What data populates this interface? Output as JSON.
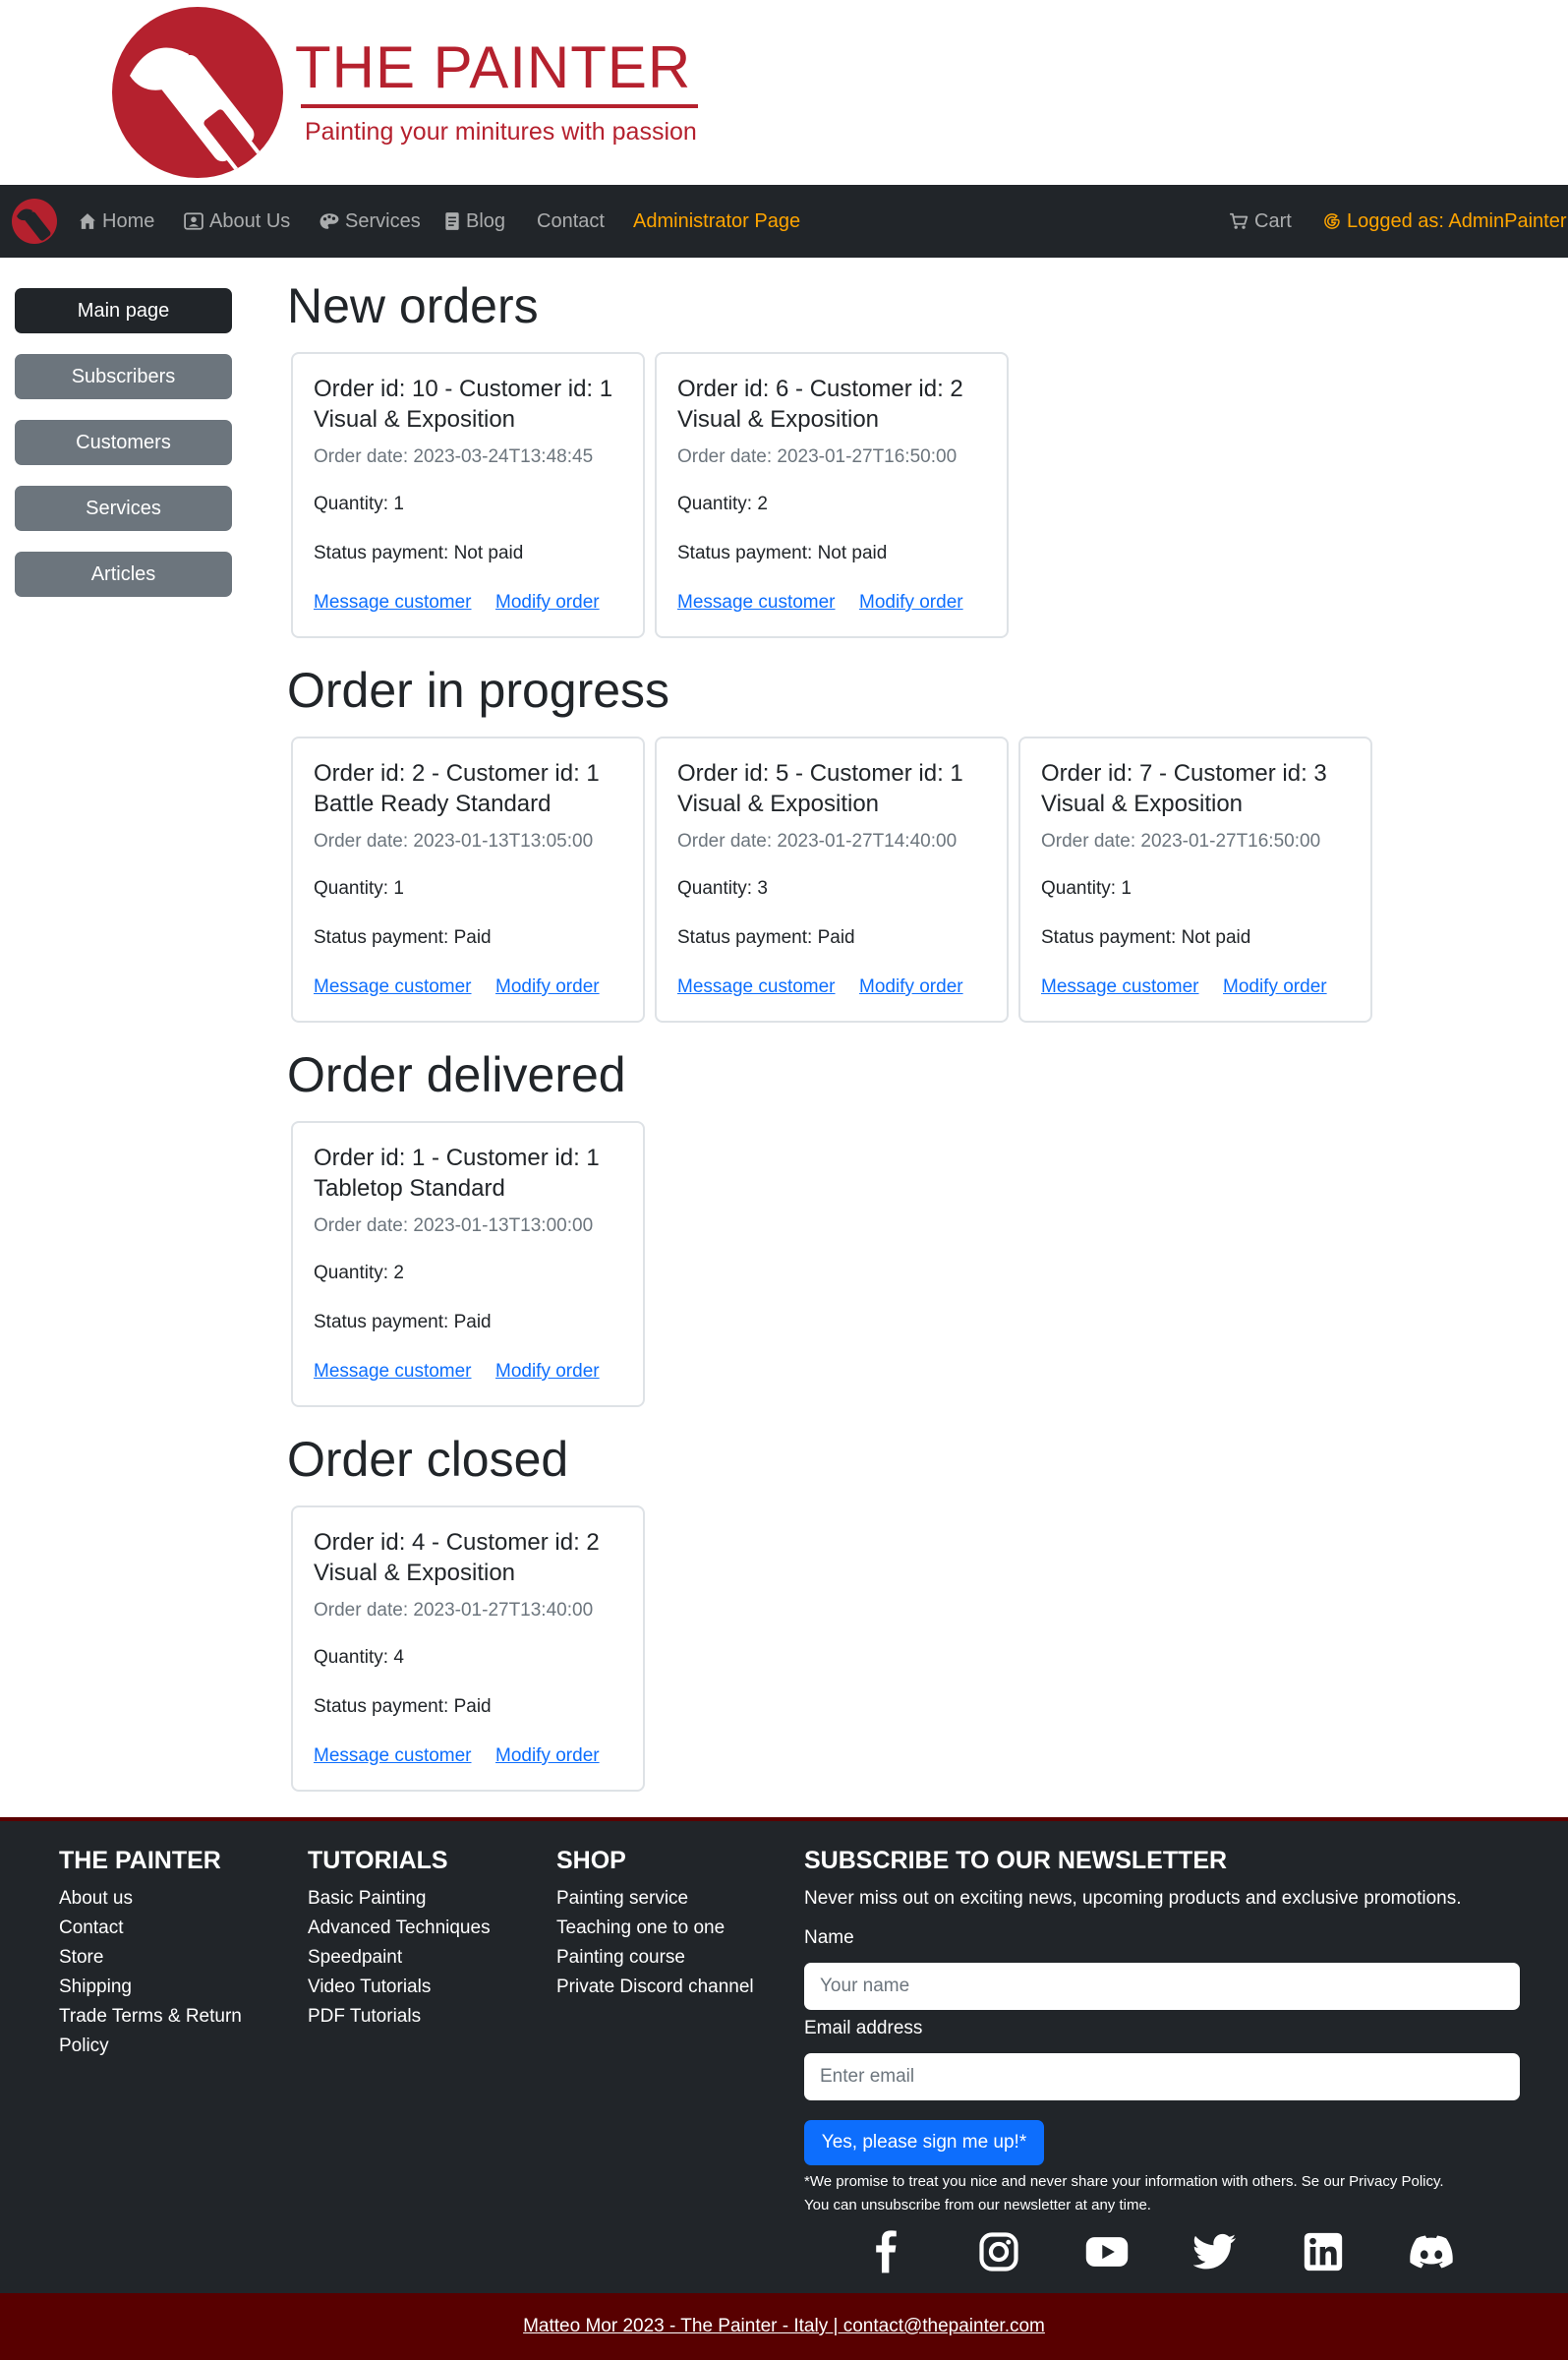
{
  "header": {
    "logo_title": "THE PAINTER",
    "logo_subtitle": "Painting your minitures with passion",
    "brand_color": "#b5212e"
  },
  "navbar": {
    "items": [
      {
        "label": "Home",
        "icon": "house-icon"
      },
      {
        "label": "About Us",
        "icon": "person-badge-icon"
      },
      {
        "label": "Services",
        "icon": "palette-icon"
      },
      {
        "label": "Blog",
        "icon": "document-icon"
      },
      {
        "label": "Contact",
        "icon": ""
      }
    ],
    "admin_label": "Administrator Page",
    "cart_label": "Cart",
    "logged_label": "Logged as: AdminPainter",
    "accent_color": "#ffa500"
  },
  "sidebar": {
    "items": [
      {
        "label": "Main page",
        "active": true
      },
      {
        "label": "Subscribers",
        "active": false
      },
      {
        "label": "Customers",
        "active": false
      },
      {
        "label": "Services",
        "active": false
      },
      {
        "label": "Articles",
        "active": false
      }
    ]
  },
  "sections": [
    {
      "title": "New orders",
      "cards": [
        {
          "line1": "Order id: 10 - Customer id: 1",
          "line2": "Visual & Exposition",
          "date": "Order date: 2023-03-24T13:48:45",
          "quantity": "Quantity: 1",
          "status": "Status payment: Not paid",
          "msg": "Message customer",
          "modify": "Modify order"
        },
        {
          "line1": "Order id: 6 - Customer id: 2",
          "line2": "Visual & Exposition",
          "date": "Order date: 2023-01-27T16:50:00",
          "quantity": "Quantity: 2",
          "status": "Status payment: Not paid",
          "msg": "Message customer",
          "modify": "Modify order"
        }
      ]
    },
    {
      "title": "Order in progress",
      "cards": [
        {
          "line1": "Order id: 2 - Customer id: 1",
          "line2": "Battle Ready Standard",
          "date": "Order date: 2023-01-13T13:05:00",
          "quantity": "Quantity: 1",
          "status": "Status payment: Paid",
          "msg": "Message customer",
          "modify": "Modify order"
        },
        {
          "line1": "Order id: 5 - Customer id: 1",
          "line2": "Visual & Exposition",
          "date": "Order date: 2023-01-27T14:40:00",
          "quantity": "Quantity: 3",
          "status": "Status payment: Paid",
          "msg": "Message customer",
          "modify": "Modify order"
        },
        {
          "line1": "Order id: 7 - Customer id: 3",
          "line2": "Visual & Exposition",
          "date": "Order date: 2023-01-27T16:50:00",
          "quantity": "Quantity: 1",
          "status": "Status payment: Not paid",
          "msg": "Message customer",
          "modify": "Modify order"
        }
      ]
    },
    {
      "title": "Order delivered",
      "cards": [
        {
          "line1": "Order id: 1 - Customer id: 1",
          "line2": "Tabletop Standard",
          "date": "Order date: 2023-01-13T13:00:00",
          "quantity": "Quantity: 2",
          "status": "Status payment: Paid",
          "msg": "Message customer",
          "modify": "Modify order"
        }
      ]
    },
    {
      "title": "Order closed",
      "cards": [
        {
          "line1": "Order id: 4 - Customer id: 2",
          "line2": "Visual & Exposition",
          "date": "Order date: 2023-01-27T13:40:00",
          "quantity": "Quantity: 4",
          "status": "Status payment: Paid",
          "msg": "Message customer",
          "modify": "Modify order"
        }
      ]
    }
  ],
  "footer": {
    "columns": [
      {
        "heading": "THE PAINTER",
        "links": [
          "About us",
          "Contact",
          "Store",
          "Shipping",
          "Trade Terms & Return",
          "Policy"
        ]
      },
      {
        "heading": "TUTORIALS",
        "links": [
          "Basic Painting",
          "Advanced Techniques",
          "Speedpaint",
          "Video Tutorials",
          "PDF Tutorials"
        ]
      },
      {
        "heading": "SHOP",
        "links": [
          "Painting service",
          "Teaching one to one",
          "Painting course",
          "Private Discord channel"
        ]
      }
    ],
    "newsletter": {
      "heading": "SUBSCRIBE TO OUR NEWSLETTER",
      "intro": "Never miss out on exciting news, upcoming products and exclusive promotions.",
      "name_label": "Name",
      "name_placeholder": "Your name",
      "email_label": "Email address",
      "email_placeholder": "Enter email",
      "button": "Yes, please sign me up!*",
      "note1": "*We promise to treat you nice and never share your information with others. Se our Privacy Policy.",
      "note2": "You can unsubscribe from our newsletter at any time."
    },
    "social": [
      "facebook-icon",
      "instagram-icon",
      "youtube-icon",
      "twitter-icon",
      "linkedin-icon",
      "discord-icon"
    ],
    "bottom_text": "Matteo Mor 2023 - The Painter - Italy | contact@thepainter.com",
    "bottom_color": "#580000"
  }
}
